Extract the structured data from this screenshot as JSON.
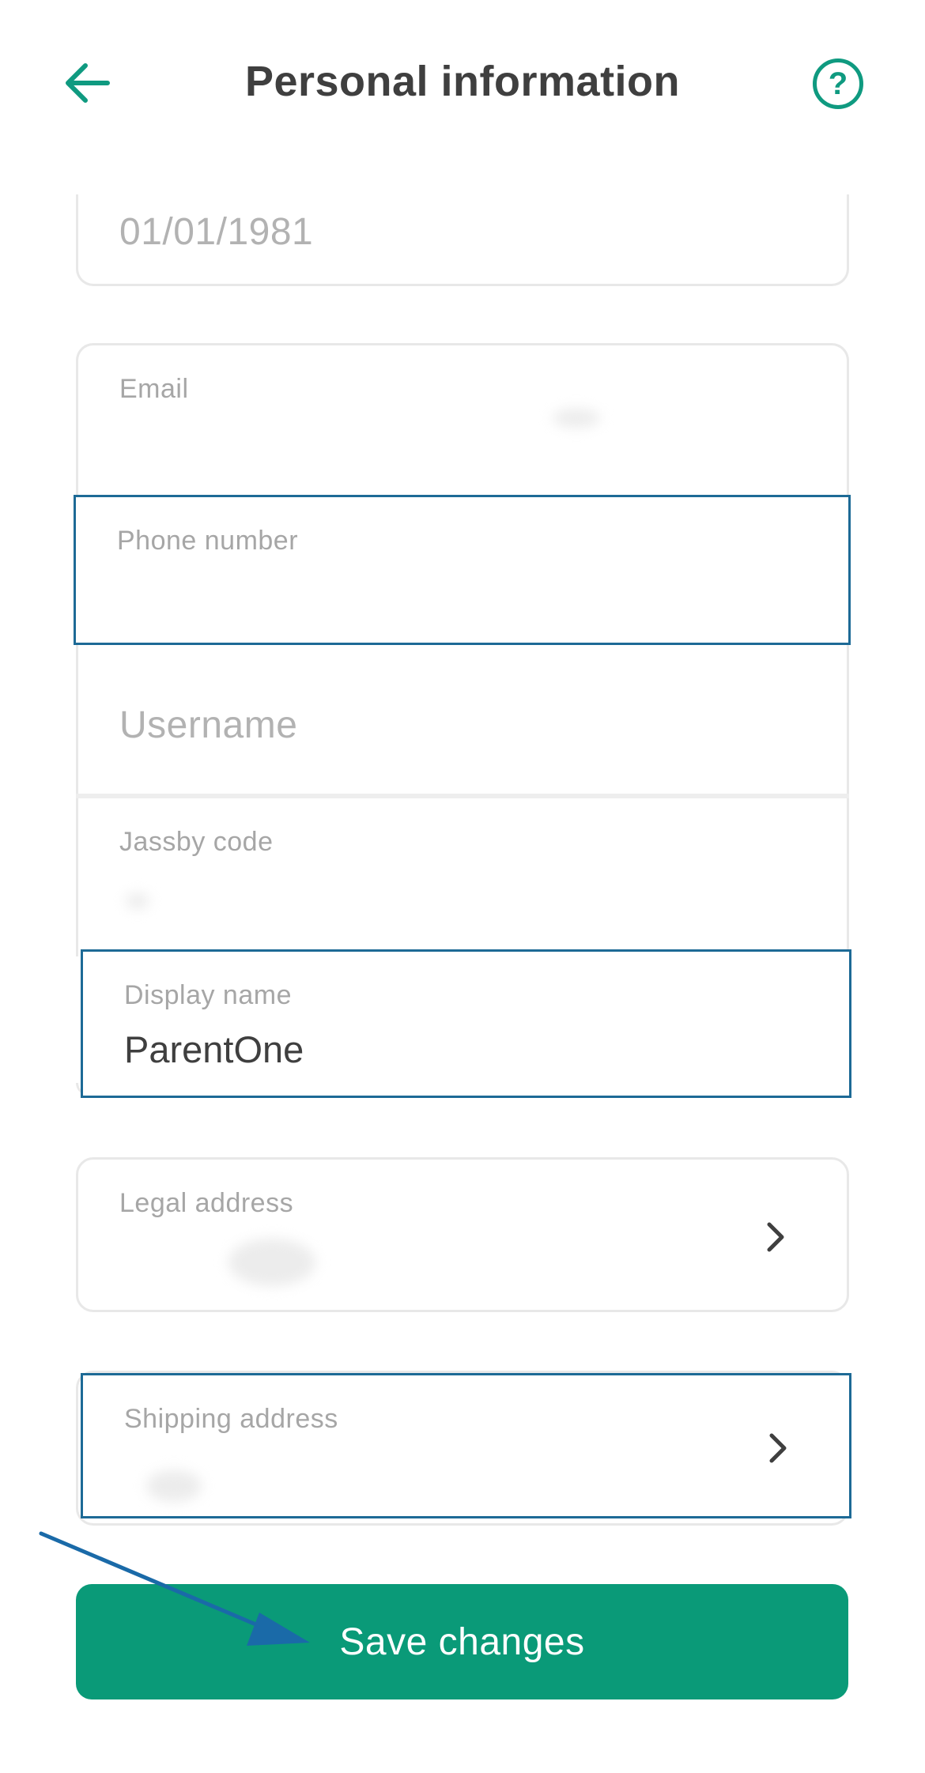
{
  "header": {
    "title": "Personal information",
    "back_icon": "arrow-left-icon",
    "help_icon": "question-circle-icon",
    "help_glyph": "?"
  },
  "form": {
    "date_of_birth": {
      "value": "01/01/1981"
    },
    "email": {
      "label": "Email"
    },
    "phone": {
      "label": "Phone number"
    },
    "username": {
      "placeholder": "Username"
    },
    "jassby_code": {
      "label": "Jassby code"
    },
    "display_name": {
      "label": "Display name",
      "value": "ParentOne"
    },
    "legal_address": {
      "label": "Legal address",
      "icon": "chevron-right-icon"
    },
    "shipping_address": {
      "label": "Shipping address",
      "icon": "chevron-right-icon"
    }
  },
  "actions": {
    "save_label": "Save changes"
  },
  "colors": {
    "accent": "#0a9a78",
    "highlight_border": "#1d6a96",
    "annotation_arrow": "#1a6aa8"
  }
}
